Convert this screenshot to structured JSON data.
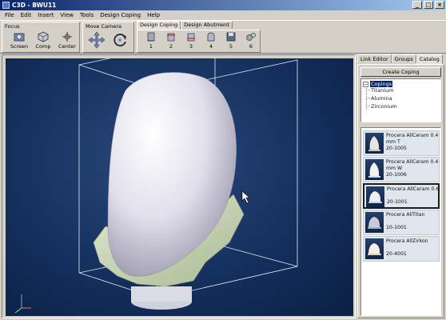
{
  "window": {
    "title": "C3D - BWU11",
    "min": "_",
    "max": "□",
    "close": "×"
  },
  "menu": [
    "File",
    "Edit",
    "Insert",
    "View",
    "Tools",
    "Design Coping",
    "Help"
  ],
  "toolbar": {
    "focus": {
      "title": "Focus",
      "buttons": [
        "Screen",
        "Comp",
        "Center"
      ]
    },
    "move_camera": {
      "title": "Move Camera"
    },
    "tabs": [
      "Design Coping",
      "Design Abutment"
    ],
    "step_buttons": [
      "1",
      "2",
      "3",
      "4",
      "5",
      "6"
    ]
  },
  "panel": {
    "tabs": [
      "Link Editor",
      "Groups",
      "Catalog"
    ],
    "create_button": "Create Coping",
    "tree": {
      "root": "Copings",
      "children": [
        "Titanium",
        "Alumina",
        "Zirconium"
      ]
    },
    "catalog": [
      {
        "name": "Procera AllCeram 0.4 mm T",
        "code": "20-1005"
      },
      {
        "name": "Procera AllCeram 0.4 mm W",
        "code": "20-1006"
      },
      {
        "name": "Procera AllCeram 0.6",
        "code": "20-1001"
      },
      {
        "name": "Procera AllTitan",
        "code": "10-1001"
      },
      {
        "name": "Procera AllZirkon",
        "code": "20-4001"
      }
    ]
  },
  "colors": {
    "accent": "#0a246a",
    "viewport_bg": "#14305e",
    "coping": "#e8e6f0",
    "gum": "#c8d6b4"
  }
}
